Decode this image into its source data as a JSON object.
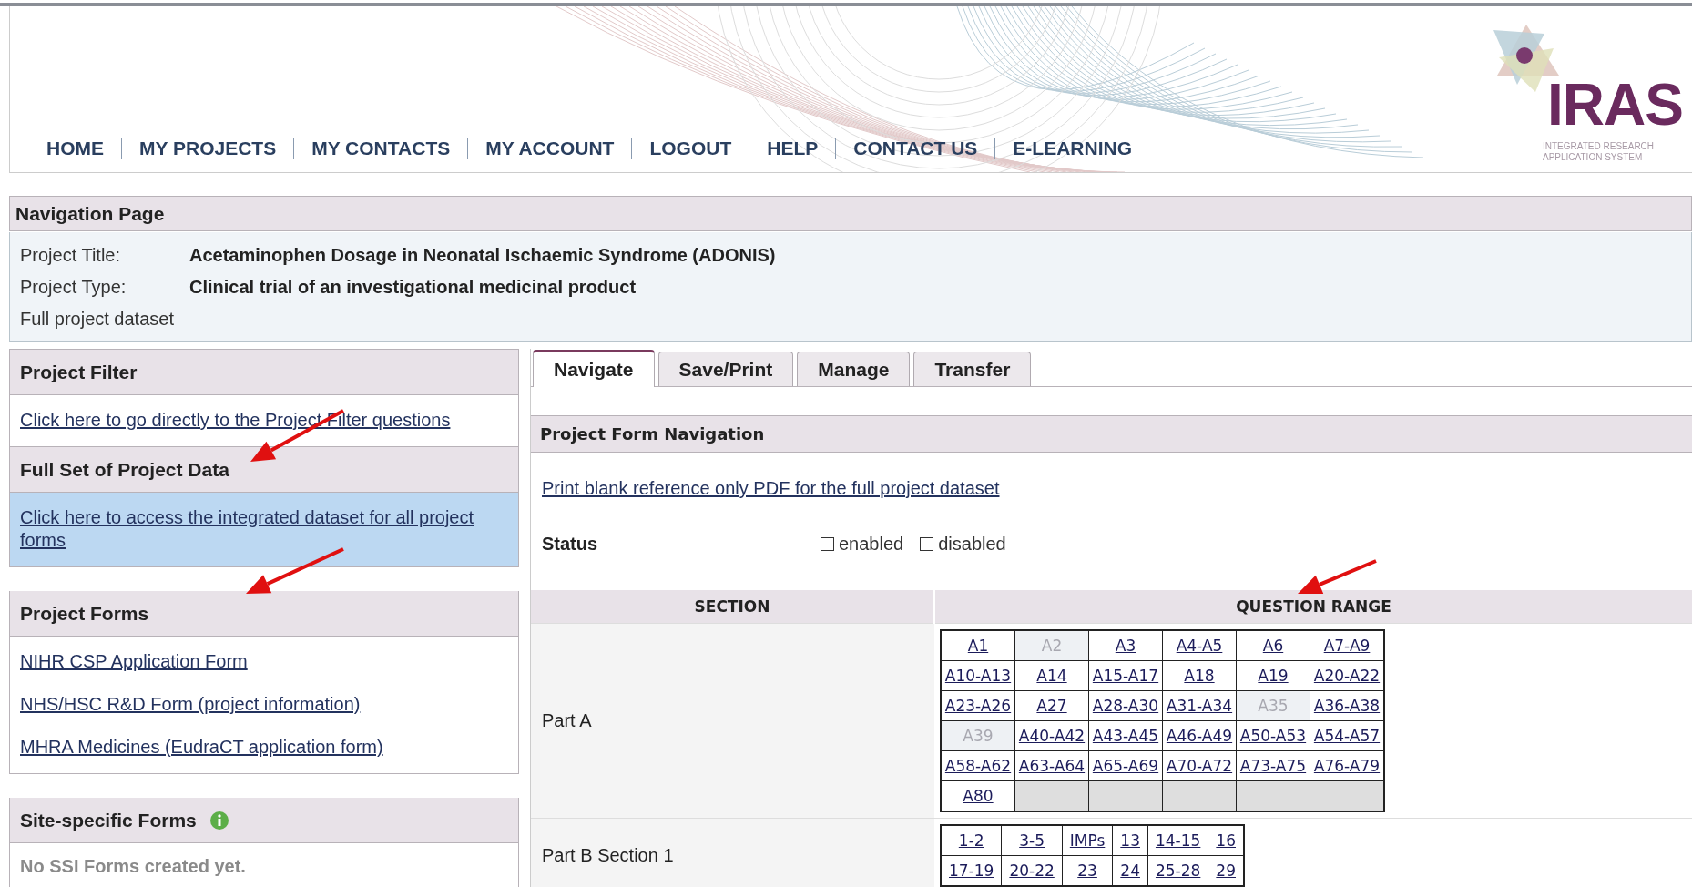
{
  "header": {
    "nav": [
      {
        "label": "HOME"
      },
      {
        "label": "MY PROJECTS"
      },
      {
        "label": "MY CONTACTS"
      },
      {
        "label": "MY ACCOUNT"
      },
      {
        "label": "LOGOUT"
      },
      {
        "label": "HELP"
      },
      {
        "label": "CONTACT US"
      },
      {
        "label": "E-LEARNING"
      }
    ],
    "logo": {
      "name": "IRAS",
      "tagline": [
        "INTEGRATED RESEARCH",
        "APPLICATION SYSTEM"
      ]
    }
  },
  "page_title": "Navigation Page",
  "project": {
    "fields": [
      {
        "label": "Project Title:",
        "value": "Acetaminophen Dosage in Neonatal Ischaemic Syndrome (ADONIS)"
      },
      {
        "label": "Project Type:",
        "value": "Clinical trial of an investigational medicinal product"
      }
    ],
    "note": "Full project dataset"
  },
  "sidebar": [
    {
      "title": "Project Filter",
      "kind": "links",
      "highlighted": false,
      "links": [
        "Click here to go directly to the Project Filter questions"
      ]
    },
    {
      "title": "Full Set of Project Data",
      "kind": "links",
      "highlighted": true,
      "links": [
        "Click here to access the integrated dataset for all project forms"
      ]
    },
    {
      "title": "Project Forms",
      "kind": "links",
      "highlighted": false,
      "links": [
        "NIHR CSP Application Form",
        "NHS/HSC R&D Form (project information)",
        "MHRA Medicines (EudraCT application form)"
      ]
    },
    {
      "title": "Site-specific Forms",
      "kind": "note",
      "info": true,
      "highlighted": false,
      "text": "No SSI Forms created yet."
    }
  ],
  "tabs": [
    {
      "label": "Navigate",
      "selected": true
    },
    {
      "label": "Save/Print",
      "selected": false
    },
    {
      "label": "Manage",
      "selected": false
    },
    {
      "label": "Transfer",
      "selected": false
    }
  ],
  "panel": {
    "title": "Project Form Navigation",
    "print_link": "Print blank reference only PDF for the full project dataset",
    "status": {
      "label": "Status",
      "options": [
        {
          "label": "enabled",
          "checked": false
        },
        {
          "label": "disabled",
          "checked": false
        }
      ]
    },
    "table": {
      "columns": [
        "SECTION",
        "QUESTION RANGE"
      ],
      "parts": [
        {
          "section": "Part A",
          "rows": [
            [
              {
                "text": "A1",
                "disabled": false
              },
              {
                "text": "A2",
                "disabled": true
              },
              {
                "text": "A3",
                "disabled": false
              },
              {
                "text": "A4-A5",
                "disabled": false
              },
              {
                "text": "A6",
                "disabled": false
              },
              {
                "text": "A7-A9",
                "disabled": false
              }
            ],
            [
              {
                "text": "A10-A13",
                "disabled": false
              },
              {
                "text": "A14",
                "disabled": false
              },
              {
                "text": "A15-A17",
                "disabled": false
              },
              {
                "text": "A18",
                "disabled": false
              },
              {
                "text": "A19",
                "disabled": false
              },
              {
                "text": "A20-A22",
                "disabled": false
              }
            ],
            [
              {
                "text": "A23-A26",
                "disabled": false
              },
              {
                "text": "A27",
                "disabled": false
              },
              {
                "text": "A28-A30",
                "disabled": false
              },
              {
                "text": "A31-A34",
                "disabled": false
              },
              {
                "text": "A35",
                "disabled": true
              },
              {
                "text": "A36-A38",
                "disabled": false
              }
            ],
            [
              {
                "text": "A39",
                "disabled": true
              },
              {
                "text": "A40-A42",
                "disabled": false
              },
              {
                "text": "A43-A45",
                "disabled": false
              },
              {
                "text": "A46-A49",
                "disabled": false
              },
              {
                "text": "A50-A53",
                "disabled": false
              },
              {
                "text": "A54-A57",
                "disabled": false
              }
            ],
            [
              {
                "text": "A58-A62",
                "disabled": false
              },
              {
                "text": "A63-A64",
                "disabled": false
              },
              {
                "text": "A65-A69",
                "disabled": false
              },
              {
                "text": "A70-A72",
                "disabled": false
              },
              {
                "text": "A73-A75",
                "disabled": false
              },
              {
                "text": "A76-A79",
                "disabled": false
              }
            ],
            [
              {
                "text": "A80",
                "disabled": false
              }
            ]
          ]
        },
        {
          "section": "Part B Section 1",
          "rows": [
            [
              {
                "text": "1-2",
                "disabled": false
              },
              {
                "text": "3-5",
                "disabled": false
              },
              {
                "text": "IMPs",
                "disabled": false
              },
              {
                "text": "13",
                "disabled": false
              },
              {
                "text": "14-15",
                "disabled": false
              },
              {
                "text": "16",
                "disabled": false
              }
            ],
            [
              {
                "text": "17-19",
                "disabled": false
              },
              {
                "text": "20-22",
                "disabled": false
              },
              {
                "text": "23",
                "disabled": false
              },
              {
                "text": "24",
                "disabled": false
              },
              {
                "text": "25-28",
                "disabled": false
              },
              {
                "text": "29",
                "disabled": false
              }
            ]
          ]
        }
      ]
    }
  }
}
